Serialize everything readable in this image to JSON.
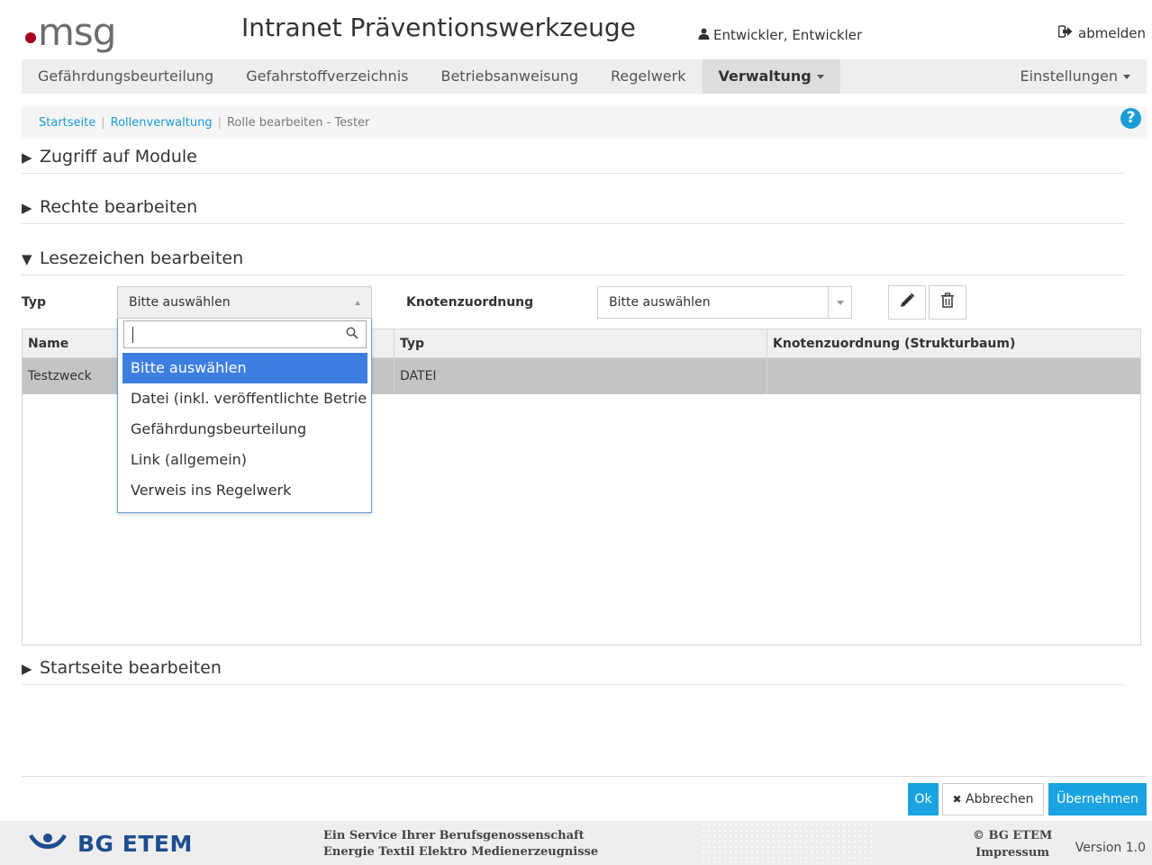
{
  "header": {
    "logo_text": "msg",
    "app_title": "Intranet Präventionswerkzeuge",
    "user_name": "Entwickler, Entwickler",
    "logout_label": "abmelden"
  },
  "nav": {
    "items": [
      {
        "label": "Gefährdungsbeurteilung"
      },
      {
        "label": "Gefahrstoffverzeichnis"
      },
      {
        "label": "Betriebsanweisung"
      },
      {
        "label": "Regelwerk"
      },
      {
        "label": "Verwaltung"
      }
    ],
    "settings_label": "Einstellungen"
  },
  "breadcrumb": {
    "items": [
      "Startseite",
      "Rollenverwaltung",
      "Rolle bearbeiten - Tester"
    ],
    "help": "?"
  },
  "sections": {
    "modules": "Zugriff auf Module",
    "rights": "Rechte bearbeiten",
    "bookmarks": "Lesezeichen bearbeiten",
    "startpage": "Startseite bearbeiten"
  },
  "filters": {
    "typ_label": "Typ",
    "typ_value": "Bitte auswählen",
    "knoten_label": "Knotenzuordnung",
    "knoten_value": "Bitte auswählen"
  },
  "dropdown": {
    "search_value": "",
    "options": [
      "Bitte auswählen",
      "Datei (inkl. veröffentlichte Betriebsanweisung)",
      "Gefährdungsbeurteilung",
      "Link (allgemein)",
      "Verweis ins Regelwerk"
    ],
    "selected_index": 0
  },
  "table": {
    "headers": [
      "Name",
      "Typ",
      "Knotenzuordnung (Strukturbaum)"
    ],
    "rows": [
      {
        "name": "Testzweck",
        "typ": "DATEI",
        "knoten": ""
      }
    ]
  },
  "actions": {
    "ok": "Ok",
    "cancel": "Abbrechen",
    "apply": "Übernehmen"
  },
  "footer": {
    "brand": "BG ETEM",
    "service_line1": "Ein Service Ihrer Berufsgenossenschaft",
    "service_line2": "Energie Textil Elektro Medienerzeugnisse",
    "copyright": "© BG ETEM",
    "impressum": "Impressum",
    "version": "Version 1.0"
  },
  "colors": {
    "accent": "#1aa3e0",
    "selected_option": "#3d7fe0",
    "logo_dot": "#a6001e",
    "bg_brand": "#1d4d90"
  }
}
